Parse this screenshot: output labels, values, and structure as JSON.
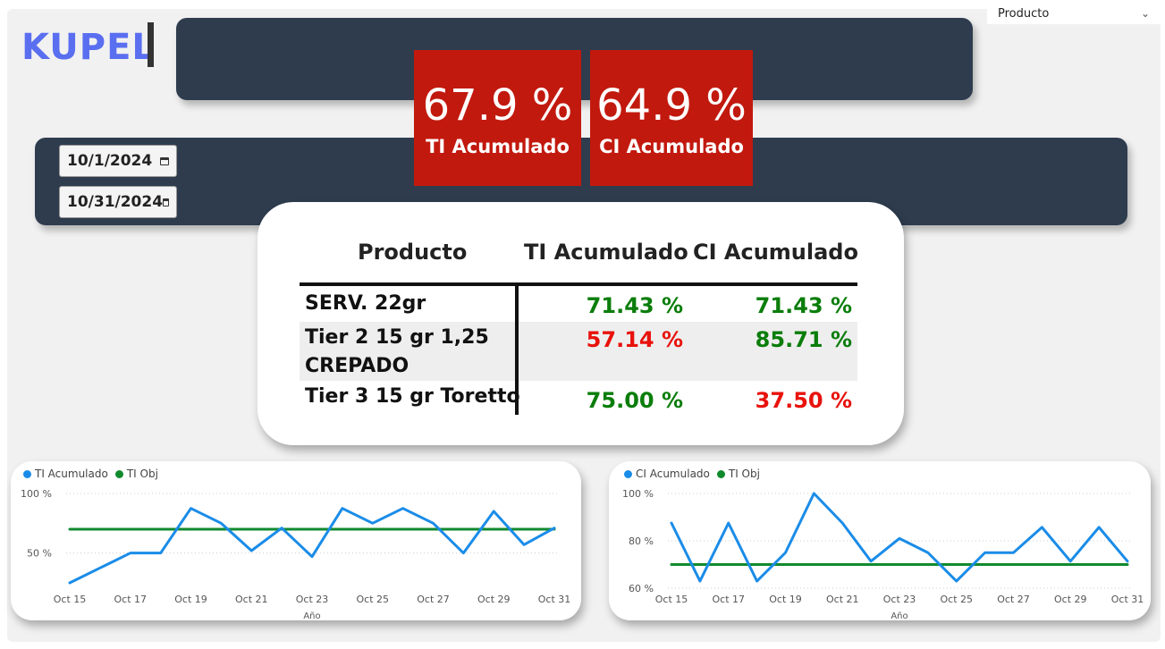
{
  "slicer": {
    "label": "Producto"
  },
  "brand": {
    "logo": "KUPEL"
  },
  "dates": {
    "start": "10/1/2024",
    "end": "10/31/2024"
  },
  "kpis": [
    {
      "value": "67.9 %",
      "label": "TI Acumulado"
    },
    {
      "value": "64.9 %",
      "label": "CI Acumulado"
    }
  ],
  "table": {
    "headers": [
      "Producto",
      "TI Acumulado",
      "CI Acumulado"
    ],
    "rows": [
      {
        "name": "SERV. 22gr",
        "ti": "71.43 %",
        "ci": "71.43 %",
        "ti_color": "#0a7d0a",
        "ci_color": "#0a7d0a"
      },
      {
        "name": "Tier 2 15 gr 1,25 CREPADO",
        "name_line1": "Tier 2 15 gr 1,25",
        "name_line2": "CREPADO",
        "ti": "57.14 %",
        "ci": "85.71 %",
        "ti_color": "#e8120c",
        "ci_color": "#0a7d0a"
      },
      {
        "name": "Tier 3 15 gr Toretto",
        "ti": "75.00 %",
        "ci": "37.50 %",
        "ti_color": "#0a7d0a",
        "ci_color": "#e8120c"
      }
    ]
  },
  "chart_data": [
    {
      "type": "line",
      "legend": [
        "TI Acumulado",
        "TI Obj"
      ],
      "xlabel": "Año",
      "ylabel": "",
      "x_ticks": [
        "Oct 15",
        "Oct 17",
        "Oct 19",
        "Oct 21",
        "Oct 23",
        "Oct 25",
        "Oct 27",
        "Oct 29",
        "Oct 31"
      ],
      "y_ticks": [
        "50 %",
        "100 %"
      ],
      "ylim": [
        25,
        100
      ],
      "x": [
        15,
        16,
        17,
        18,
        19,
        20,
        21,
        22,
        23,
        24,
        25,
        26,
        27,
        28,
        29,
        30,
        31
      ],
      "series": [
        {
          "name": "TI Acumulado",
          "color": "#1a8ce8",
          "values": [
            25,
            37.5,
            50,
            50,
            87.5,
            75,
            52,
            71,
            47,
            87.5,
            75,
            87.5,
            75,
            50,
            85,
            57,
            71
          ]
        },
        {
          "name": "TI Obj",
          "color": "#118a2e",
          "values": [
            70,
            70,
            70,
            70,
            70,
            70,
            70,
            70,
            70,
            70,
            70,
            70,
            70,
            70,
            70,
            70,
            70
          ]
        }
      ]
    },
    {
      "type": "line",
      "legend": [
        "CI Acumulado",
        "TI Obj"
      ],
      "xlabel": "Año",
      "ylabel": "",
      "x_ticks": [
        "Oct 15",
        "Oct 17",
        "Oct 19",
        "Oct 21",
        "Oct 23",
        "Oct 25",
        "Oct 27",
        "Oct 29",
        "Oct 31"
      ],
      "y_ticks": [
        "60 %",
        "80 %",
        "100 %"
      ],
      "ylim": [
        60,
        100
      ],
      "x": [
        15,
        16,
        17,
        18,
        19,
        20,
        21,
        22,
        23,
        24,
        25,
        26,
        27,
        28,
        29,
        30,
        31
      ],
      "series": [
        {
          "name": "CI Acumulado",
          "color": "#1a8ce8",
          "values": [
            87.5,
            63,
            87.5,
            63,
            75,
            100,
            87.5,
            71.4,
            81,
            75,
            63,
            75,
            75,
            85.7,
            71.4,
            85.7,
            71.4
          ]
        },
        {
          "name": "TI Obj",
          "color": "#118a2e",
          "values": [
            70,
            70,
            70,
            70,
            70,
            70,
            70,
            70,
            70,
            70,
            70,
            70,
            70,
            70,
            70,
            70,
            70
          ]
        }
      ]
    }
  ]
}
